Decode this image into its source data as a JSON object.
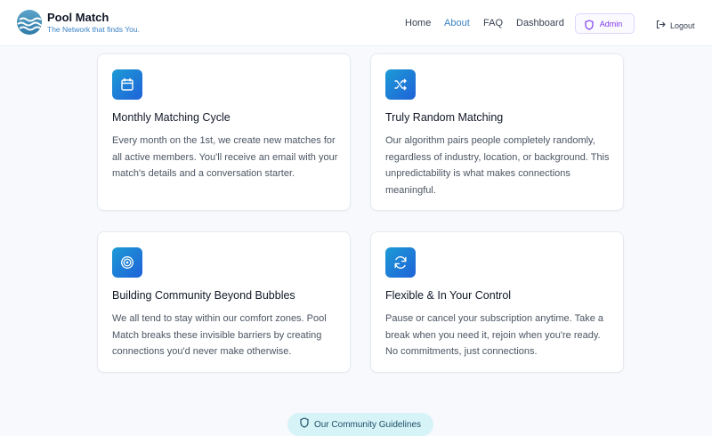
{
  "brand": {
    "name": "Pool Match",
    "tagline": "The Network that finds You."
  },
  "nav": {
    "home": "Home",
    "about": "About",
    "faq": "FAQ",
    "dashboard": "Dashboard",
    "admin": "Admin",
    "logout": "Logout",
    "active": "About"
  },
  "features": [
    {
      "icon": "calendar-icon",
      "title": "Monthly Matching Cycle",
      "description": "Every month on the 1st, we create new matches for all active members. You'll receive an email with your match's details and a conversation starter."
    },
    {
      "icon": "shuffle-icon",
      "title": "Truly Random Matching",
      "description": "Our algorithm pairs people completely randomly, regardless of industry, location, or background. This unpredictability is what makes connections meaningful."
    },
    {
      "icon": "target-icon",
      "title": "Building Community Beyond Bubbles",
      "description": "We all tend to stay within our comfort zones. Pool Match breaks these invisible barriers by creating connections you'd never make otherwise."
    },
    {
      "icon": "refresh-icon",
      "title": "Flexible & In Your Control",
      "description": "Pause or cancel your subscription anytime. Take a break when you need it, rejoin when you're ready. No commitments, just connections."
    }
  ],
  "guidelines": {
    "label": "Our Community Guidelines",
    "icon": "shield-icon"
  },
  "colors": {
    "accent": "#3b82c4",
    "admin": "#7c3aed",
    "icon_gradient_start": "#1d9bd6",
    "icon_gradient_end": "#1e62d8",
    "guidelines_bg": "#d6f3f8"
  }
}
